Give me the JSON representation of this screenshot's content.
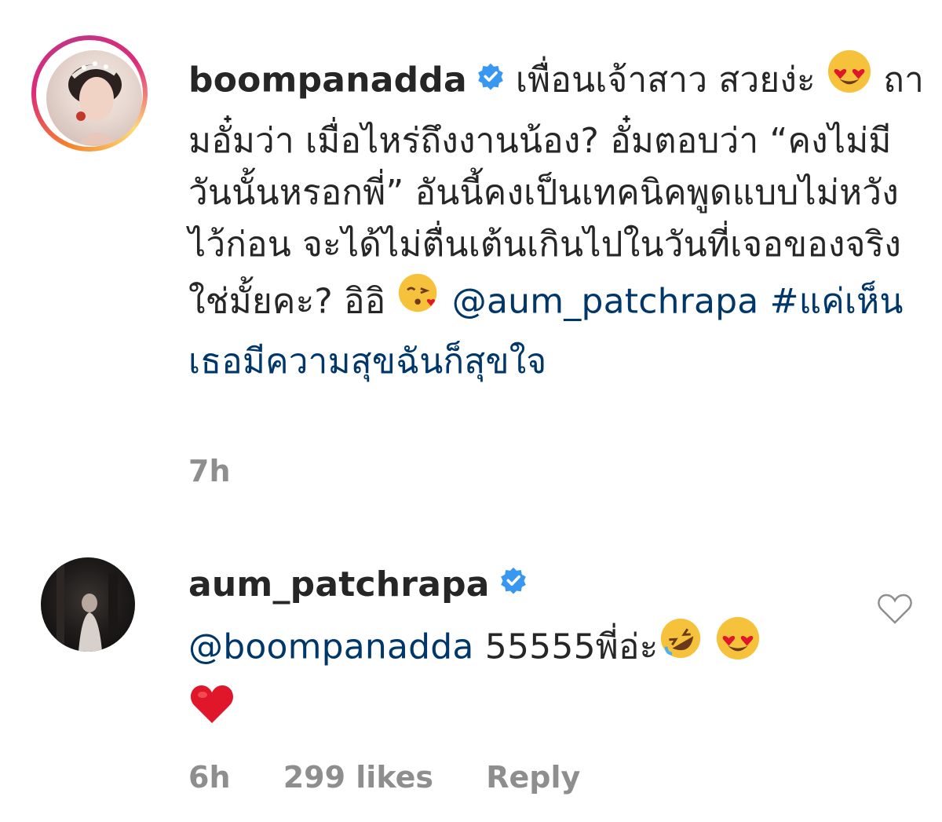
{
  "comments": [
    {
      "username": "boompanadda",
      "verified": true,
      "text_line1": "เพื่อนเจ้าสาว สวยง่ะ",
      "text_rest": "ถามอั๋มว่า เมื่อไหร่ถึงงานน้อง? อั๋มตอบว่า “คงไม่มีวันนั้นหรอกพี่” อันนี้คงเป็นเทคนิคพูดแบบไม่หวังไว้ก่อน จะได้ไม่ตื่นเต้นเกินไปในวันที่เจอของจริงใช่มั้ยคะ? อิอิ",
      "mention": "@aum_patchrapa",
      "hashtag": "#แค่เห็นเธอมีความสุขฉันก็สุขใจ",
      "time": "7h"
    },
    {
      "username": "aum_patchrapa",
      "verified": true,
      "mention": "@boompanadda",
      "text": "55555พี่อ่ะ",
      "time": "6h",
      "likes": "299 likes",
      "reply": "Reply"
    }
  ],
  "icons": {
    "verified_color": "#3897f0",
    "heart_emoji_color": "#e0172b",
    "like_outline_color": "#8e8e8e"
  }
}
